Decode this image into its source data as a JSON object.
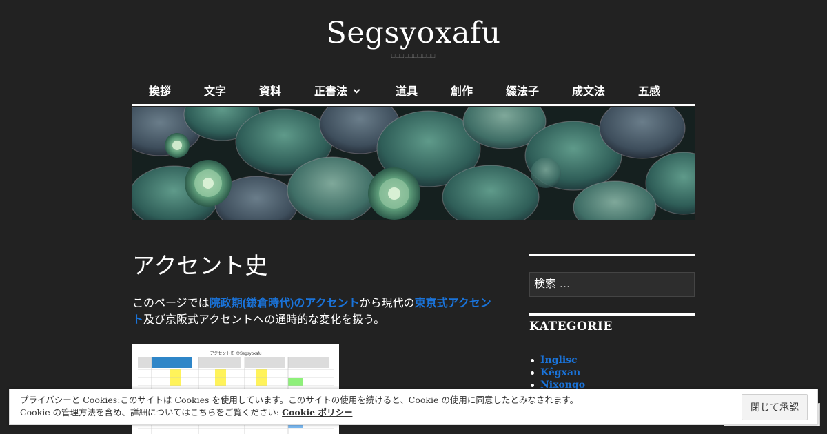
{
  "site": {
    "title": "Segsyoxafu",
    "description": "□□□□□□□□□□"
  },
  "nav": {
    "items": [
      "挨拶",
      "文字",
      "資料",
      "正書法",
      "道具",
      "創作",
      "綴法子",
      "成文法",
      "五感"
    ]
  },
  "article": {
    "title": "アクセント史",
    "intro_before": "このページでは",
    "link1": "院政期(鎌倉時代)のアクセント",
    "intro_middle": "から現代の",
    "link2": "東京式アクセント",
    "intro_after": "及び京阪式アクセントへの通時的な変化を扱う。",
    "thumb_caption": "アクセント史 @Segsyoxafu"
  },
  "sidebar": {
    "search_placeholder": "検索 …",
    "categories_title": "KATEGORIE",
    "categories": [
      "Inglisc",
      "Kêgxan",
      "Nixongo"
    ]
  },
  "cookie": {
    "line1": "プライバシーと Cookies:このサイトは Cookies を使用しています。このサイトの使用を続けると、Cookie の使用に同意したとみなされます。",
    "line2": "Cookie の管理方法を含め、詳細についてはこちらをご覧ください: ",
    "policy_link": "Cookie ポリシー",
    "accept_button": "閉じて承認"
  },
  "colors": {
    "background": "#222222",
    "link": "#1a73d9",
    "text": "#ffffff"
  }
}
